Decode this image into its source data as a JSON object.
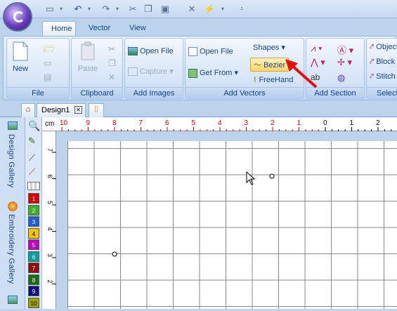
{
  "tabs": [
    "Home",
    "Vector",
    "View"
  ],
  "groups": {
    "file": {
      "label": "File",
      "new": "New"
    },
    "clipboard": {
      "label": "Clipboard",
      "paste": "Paste"
    },
    "images": {
      "label": "Add Images",
      "open_file": "Open File",
      "capture": "Capture"
    },
    "vectors": {
      "label": "Add Vectors",
      "open_file": "Open File",
      "get_from": "Get From",
      "shapes": "Shapes",
      "bezier": "Bezier",
      "freehand": "FreeHand"
    },
    "section": {
      "label": "Add Section"
    },
    "select": {
      "label": "Select",
      "object": "Object",
      "block": "Block",
      "stitch": "Stitch"
    }
  },
  "document": {
    "tab": "Design1"
  },
  "sidebar": {
    "design_gallery": "Design Gallery",
    "embroidery_gallery": "Embroidery Gallery"
  },
  "ruler": {
    "unit": "cm",
    "h_red": [
      "10",
      "9",
      "8",
      "7",
      "6",
      "5",
      "4",
      "3",
      "2",
      "1"
    ],
    "h_black": [
      "0",
      "1",
      "2"
    ],
    "v": [
      "7",
      "6",
      "5",
      "4",
      "3",
      "2"
    ]
  },
  "swatches": [
    {
      "n": "1",
      "color": "#d40000"
    },
    {
      "n": "2",
      "color": "#3fae2a"
    },
    {
      "n": "3",
      "color": "#1f5fd1"
    },
    {
      "n": "4",
      "color": "#f2c400"
    },
    {
      "n": "5",
      "color": "#c000c0"
    },
    {
      "n": "6",
      "color": "#00a0a0"
    },
    {
      "n": "7",
      "color": "#8b1010"
    },
    {
      "n": "8",
      "color": "#1a6b1a"
    },
    {
      "n": "9",
      "color": "#101080"
    },
    {
      "n": "10",
      "color": "#a0a000"
    }
  ],
  "colors": {
    "accent_red": "#e01010",
    "ribbon_blue": "#15428b"
  }
}
